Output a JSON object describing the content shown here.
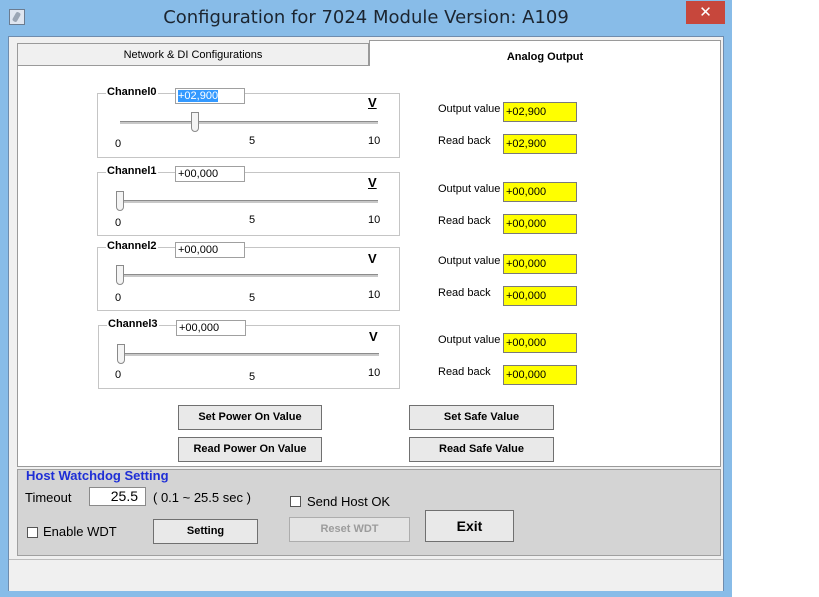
{
  "window": {
    "title": "Configuration for 7024 Module Version: A109",
    "close_glyph": "✕"
  },
  "tabs": [
    {
      "label": "Network & DI Configurations"
    },
    {
      "label": "Analog Output"
    }
  ],
  "channels": [
    {
      "label": "Channel0",
      "value": "+02,900",
      "unit": "V",
      "slider_fraction": 0.29,
      "output_label": "Output value",
      "output_value": "+02,900",
      "readback_label": "Read back",
      "readback_value": "+02,900",
      "ticks": [
        "0",
        "5",
        "10"
      ]
    },
    {
      "label": "Channel1",
      "value": "+00,000",
      "unit": "V",
      "slider_fraction": 0.0,
      "output_label": "Output value",
      "output_value": "+00,000",
      "readback_label": "Read back",
      "readback_value": "+00,000",
      "ticks": [
        "0",
        "5",
        "10"
      ]
    },
    {
      "label": "Channel2",
      "value": "+00,000",
      "unit": "V",
      "slider_fraction": 0.0,
      "output_label": "Output value",
      "output_value": "+00,000",
      "readback_label": "Read back",
      "readback_value": "+00,000",
      "ticks": [
        "0",
        "5",
        "10"
      ]
    },
    {
      "label": "Channel3",
      "value": "+00,000",
      "unit": "V",
      "slider_fraction": 0.0,
      "output_label": "Output value",
      "output_value": "+00,000",
      "readback_label": "Read back",
      "readback_value": "+00,000",
      "ticks": [
        "0",
        "5",
        "10"
      ]
    }
  ],
  "buttons": {
    "set_power_on": "Set Power On Value",
    "read_power_on": "Read Power On Value",
    "set_safe": "Set Safe Value",
    "read_safe": "Read Safe Value"
  },
  "watchdog": {
    "title": "Host Watchdog Setting",
    "timeout_label": "Timeout",
    "timeout_value": "25.5",
    "timeout_range": "( 0.1 ~ 25.5 sec )",
    "send_host_ok_label": "Send Host OK",
    "send_host_ok_checked": false,
    "enable_wdt_label": "Enable WDT",
    "enable_wdt_checked": false,
    "setting_label": "Setting",
    "reset_wdt_label": "Reset WDT",
    "exit_label": "Exit"
  },
  "colors": {
    "titlebar": "#88bce8",
    "close": "#c7473c",
    "readout_bg": "#ffff00",
    "watchdog_title": "#1e2ed6"
  }
}
